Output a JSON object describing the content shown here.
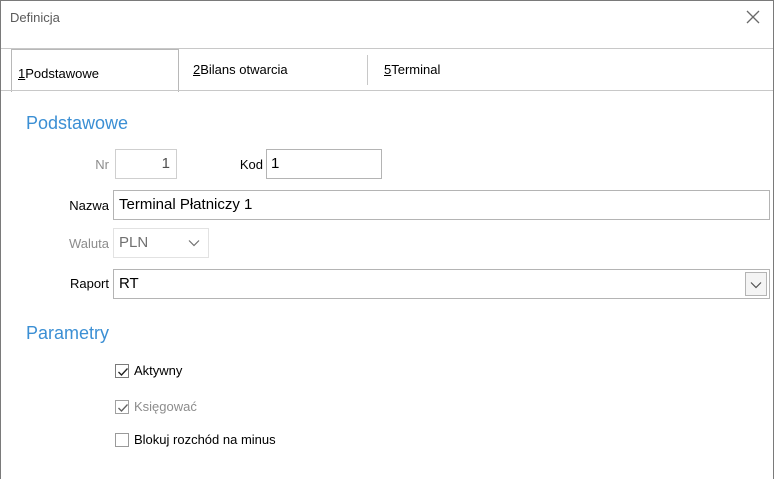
{
  "window": {
    "title": "Definicja"
  },
  "tabs": [
    {
      "key": "1",
      "label": " Podstawowe"
    },
    {
      "key": "2",
      "label": " Bilans otwarcia"
    },
    {
      "key": "5",
      "label": " Terminal"
    }
  ],
  "sections": {
    "basic": "Podstawowe",
    "params": "Parametry"
  },
  "form": {
    "nr": {
      "label": "Nr",
      "value": "1"
    },
    "kod": {
      "label": "Kod",
      "value": "1"
    },
    "nazwa": {
      "label": "Nazwa",
      "value": "Terminal Płatniczy 1"
    },
    "waluta": {
      "label": "Waluta",
      "value": "PLN"
    },
    "raport": {
      "label": "Raport",
      "value": "RT"
    }
  },
  "params": [
    {
      "label": "Aktywny",
      "checked": true,
      "enabled": true
    },
    {
      "label": "Księgować",
      "checked": true,
      "enabled": false
    },
    {
      "label": "Blokuj rozchód na minus",
      "checked": false,
      "enabled": true
    }
  ],
  "colors": {
    "accent": "#3b8fd4",
    "disabled_text": "#8c8c8c"
  },
  "icons": {
    "close": "close-icon",
    "dropdown": "chevron-down-icon",
    "check": "checkmark-icon"
  }
}
